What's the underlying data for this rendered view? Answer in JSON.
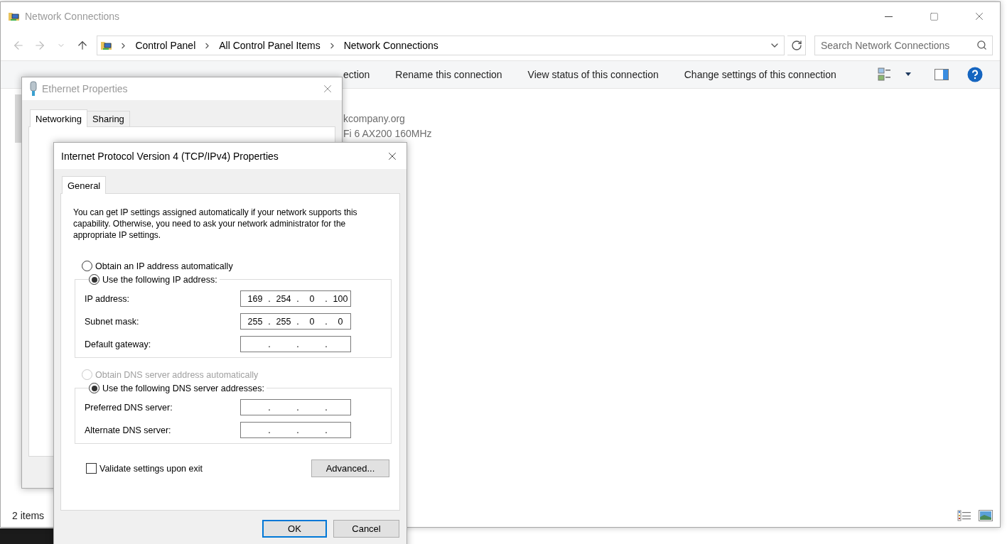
{
  "explorer": {
    "title": "Network Connections",
    "breadcrumb": [
      "Control Panel",
      "All Control Panel Items",
      "Network Connections"
    ],
    "search": {
      "placeholder": "Search Network Connections"
    },
    "toolbar": [
      "ection",
      "Rename this connection",
      "View status of this connection",
      "Change settings of this connection"
    ],
    "item_details": [
      "kcompany.org",
      "Fi 6 AX200 160MHz"
    ],
    "status_bar": "2 items"
  },
  "ethernet_dialog": {
    "title": "Ethernet Properties",
    "tabs": [
      {
        "label": "Networking",
        "selected": true
      },
      {
        "label": "Sharing",
        "selected": false
      }
    ]
  },
  "ipv4_dialog": {
    "title": "Internet Protocol Version 4 (TCP/IPv4) Properties",
    "tabs": [
      {
        "label": "General",
        "selected": true
      }
    ],
    "intro": "You can get IP settings assigned automatically if your network supports this capability. Otherwise, you need to ask your network administrator for the appropriate IP settings.",
    "separator": ".",
    "ip_options": [
      {
        "label": "Obtain an IP address automatically",
        "selected": false,
        "disabled": false
      },
      {
        "label": "Use the following IP address:",
        "selected": true,
        "disabled": false
      }
    ],
    "ip_fields": [
      {
        "label": "IP address:",
        "octets": [
          "169",
          "254",
          "0",
          "100"
        ]
      },
      {
        "label": "Subnet mask:",
        "octets": [
          "255",
          "255",
          "0",
          "0"
        ]
      },
      {
        "label": "Default gateway:"
      }
    ],
    "dns_options": [
      {
        "label": "Obtain DNS server address automatically",
        "selected": false,
        "disabled": true
      },
      {
        "label": "Use the following DNS server addresses:",
        "selected": true,
        "disabled": false
      }
    ],
    "dns_fields": [
      {
        "label": "Preferred DNS server:"
      },
      {
        "label": "Alternate DNS server:"
      }
    ],
    "validate": {
      "label": "Validate settings upon exit",
      "checked": false
    },
    "advanced_button": "Advanced...",
    "buttons": [
      {
        "label": "OK",
        "default": true
      },
      {
        "label": "Cancel",
        "default": false
      }
    ]
  }
}
